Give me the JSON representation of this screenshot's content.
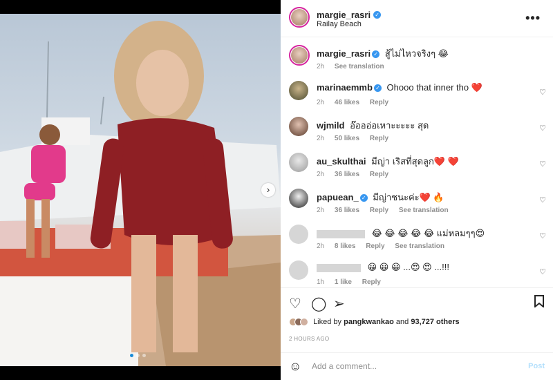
{
  "post": {
    "username": "margie_rasri",
    "location": "Railay Beach",
    "carousel": {
      "count": 3,
      "active_index": 0
    }
  },
  "caption": {
    "username": "margie_rasri",
    "text": "สู้ไม่ไหวจริงๆ 😂",
    "time": "2h",
    "see_translation": "See translation"
  },
  "comments": [
    {
      "username": "marinaemmb",
      "verified": true,
      "text": "Ohooo that inner tho ❤️",
      "time": "2h",
      "likes": "46 likes",
      "reply": "Reply",
      "translation": ""
    },
    {
      "username": "wjmild",
      "verified": false,
      "text": "อ๊อออ่อเหาะะะะะ สุด",
      "time": "2h",
      "likes": "50 likes",
      "reply": "Reply",
      "translation": ""
    },
    {
      "username": "au_skulthai",
      "verified": false,
      "text": "มีญ่า เริสที่สุดลูก❤️ ❤️",
      "time": "2h",
      "likes": "36 likes",
      "reply": "Reply",
      "translation": ""
    },
    {
      "username": "papuean_",
      "verified": true,
      "text": "มีญ่าชนะค่ะ❤️ 🔥",
      "time": "2h",
      "likes": "36 likes",
      "reply": "Reply",
      "translation": "See translation"
    },
    {
      "username": "",
      "verified": false,
      "text": "😂 😂 😂 😂 😂 แม่หลมๆๆ😍",
      "time": "2h",
      "likes": "8 likes",
      "reply": "Reply",
      "translation": "See translation"
    },
    {
      "username": "",
      "verified": false,
      "text": "😀 😀 😀 ...😍 😍 ...!!!",
      "time": "1h",
      "likes": "1 like",
      "reply": "Reply",
      "translation": ""
    }
  ],
  "liked_by": {
    "prefix": "Liked by",
    "user": "pangkwankao",
    "middle": "and",
    "others": "93,727 others"
  },
  "timestamp": "2 HOURS AGO",
  "add_comment": {
    "placeholder": "Add a comment...",
    "post_label": "Post"
  },
  "icons": {
    "more": "more-options-icon",
    "like": "heart-icon",
    "comment": "comment-icon",
    "share": "share-icon",
    "save": "bookmark-icon",
    "emoji": "emoji-icon",
    "next": "chevron-right-icon"
  },
  "colors": {
    "verified": "#3897f0",
    "link_blue": "#b2dffc",
    "heart_red": "#ed4956"
  }
}
